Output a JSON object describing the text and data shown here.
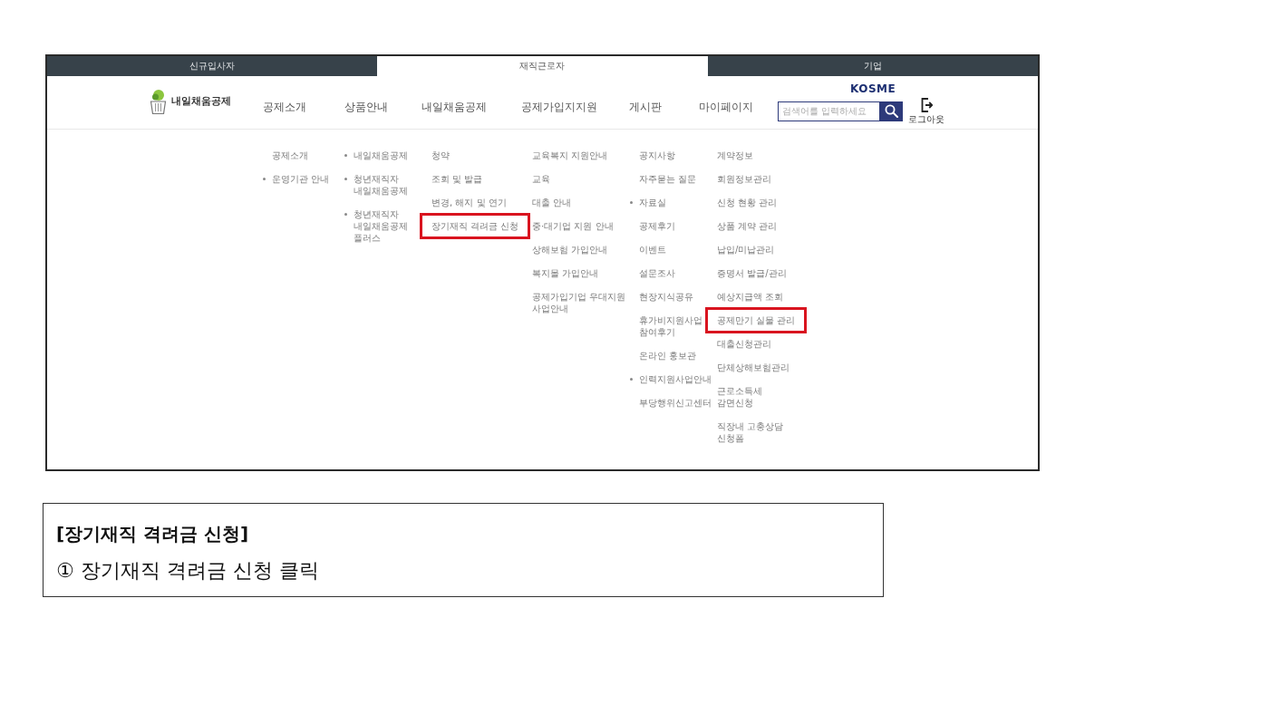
{
  "screen": {
    "audience_tabs": [
      {
        "label": "신규입사자",
        "selected": false
      },
      {
        "label": "재직근로자",
        "selected": true
      },
      {
        "label": "기업",
        "selected": false
      }
    ],
    "header": {
      "logo": {
        "text": "내일채움공제"
      },
      "nav": [
        "공제소개",
        "상품안내",
        "내일채움공제",
        "공제가입지지원",
        "게시판",
        "마이페이지"
      ],
      "agency_logo": {
        "text": "KOSME"
      },
      "search": {
        "placeholder": "검색어를 입력하세요"
      },
      "logout": {
        "label": "로그아웃"
      }
    },
    "menu_columns": [
      {
        "items": [
          {
            "label": "공제소개",
            "bullet": false,
            "highlighted": false
          },
          {
            "label": "운영기관 안내",
            "bullet": true,
            "highlighted": false
          }
        ]
      },
      {
        "items": [
          {
            "label": "내일채움공제",
            "bullet": true,
            "highlighted": false
          },
          {
            "label": "청년재직자 내일채움공제",
            "bullet": true,
            "highlighted": false
          },
          {
            "label": "청년재직자 내일채움공제 플러스",
            "bullet": true,
            "highlighted": false
          }
        ]
      },
      {
        "items": [
          {
            "label": "청약",
            "bullet": false,
            "highlighted": false
          },
          {
            "label": "조회 및 발급",
            "bullet": false,
            "highlighted": false
          },
          {
            "label": "변경, 해지 및 연기",
            "bullet": false,
            "highlighted": false
          },
          {
            "label": "장기재직 격려금 신청",
            "bullet": false,
            "highlighted": true
          }
        ]
      },
      {
        "items": [
          {
            "label": "교육복지 지원안내",
            "bullet": false,
            "highlighted": false
          },
          {
            "label": "교육",
            "bullet": false,
            "highlighted": false
          },
          {
            "label": "대출 안내",
            "bullet": false,
            "highlighted": false
          },
          {
            "label": "중·대기업 지원 안내",
            "bullet": false,
            "highlighted": false
          },
          {
            "label": "상해보험 가입안내",
            "bullet": false,
            "highlighted": false
          },
          {
            "label": "복지몰 가입안내",
            "bullet": false,
            "highlighted": false
          },
          {
            "label": "공제가입기업 우대지원 사업안내",
            "bullet": false,
            "highlighted": false
          }
        ]
      },
      {
        "items": [
          {
            "label": "공지사항",
            "bullet": false,
            "highlighted": false
          },
          {
            "label": "자주묻는 질문",
            "bullet": false,
            "highlighted": false
          },
          {
            "label": "자료실",
            "bullet": true,
            "highlighted": false
          },
          {
            "label": "공제후기",
            "bullet": false,
            "highlighted": false
          },
          {
            "label": "이벤트",
            "bullet": false,
            "highlighted": false
          },
          {
            "label": "설문조사",
            "bullet": false,
            "highlighted": false
          },
          {
            "label": "현장지식공유",
            "bullet": false,
            "highlighted": false
          },
          {
            "label": "휴가비지원사업 참여후기",
            "bullet": false,
            "highlighted": false
          },
          {
            "label": "온라인 홍보관",
            "bullet": false,
            "highlighted": false
          },
          {
            "label": "인력지원사업안내",
            "bullet": true,
            "highlighted": false
          },
          {
            "label": "부당행위신고센터",
            "bullet": false,
            "highlighted": false
          }
        ]
      },
      {
        "items": [
          {
            "label": "계약정보",
            "bullet": false,
            "highlighted": false
          },
          {
            "label": "회원정보관리",
            "bullet": false,
            "highlighted": false
          },
          {
            "label": "신청 현황 관리",
            "bullet": false,
            "highlighted": false
          },
          {
            "label": "상품 계약 관리",
            "bullet": false,
            "highlighted": false
          },
          {
            "label": "납입/미납관리",
            "bullet": false,
            "highlighted": false
          },
          {
            "label": "증명서 발급/관리",
            "bullet": false,
            "highlighted": false
          },
          {
            "label": "예상지급액 조회",
            "bullet": false,
            "highlighted": false
          },
          {
            "label": "공제만기 실물 관리",
            "bullet": false,
            "highlighted": true
          },
          {
            "label": "대출신청관리",
            "bullet": false,
            "highlighted": false
          },
          {
            "label": "단체상해보험관리",
            "bullet": false,
            "highlighted": false
          },
          {
            "label": "근로소득세 감면신청",
            "bullet": false,
            "highlighted": false
          },
          {
            "label": "직장내 고충상담 신청폼",
            "bullet": false,
            "highlighted": false
          }
        ]
      }
    ]
  },
  "caption": {
    "title": "[장기재직 격려금 신청]",
    "step": "① 장기재직 격려금 신청 클릭"
  }
}
